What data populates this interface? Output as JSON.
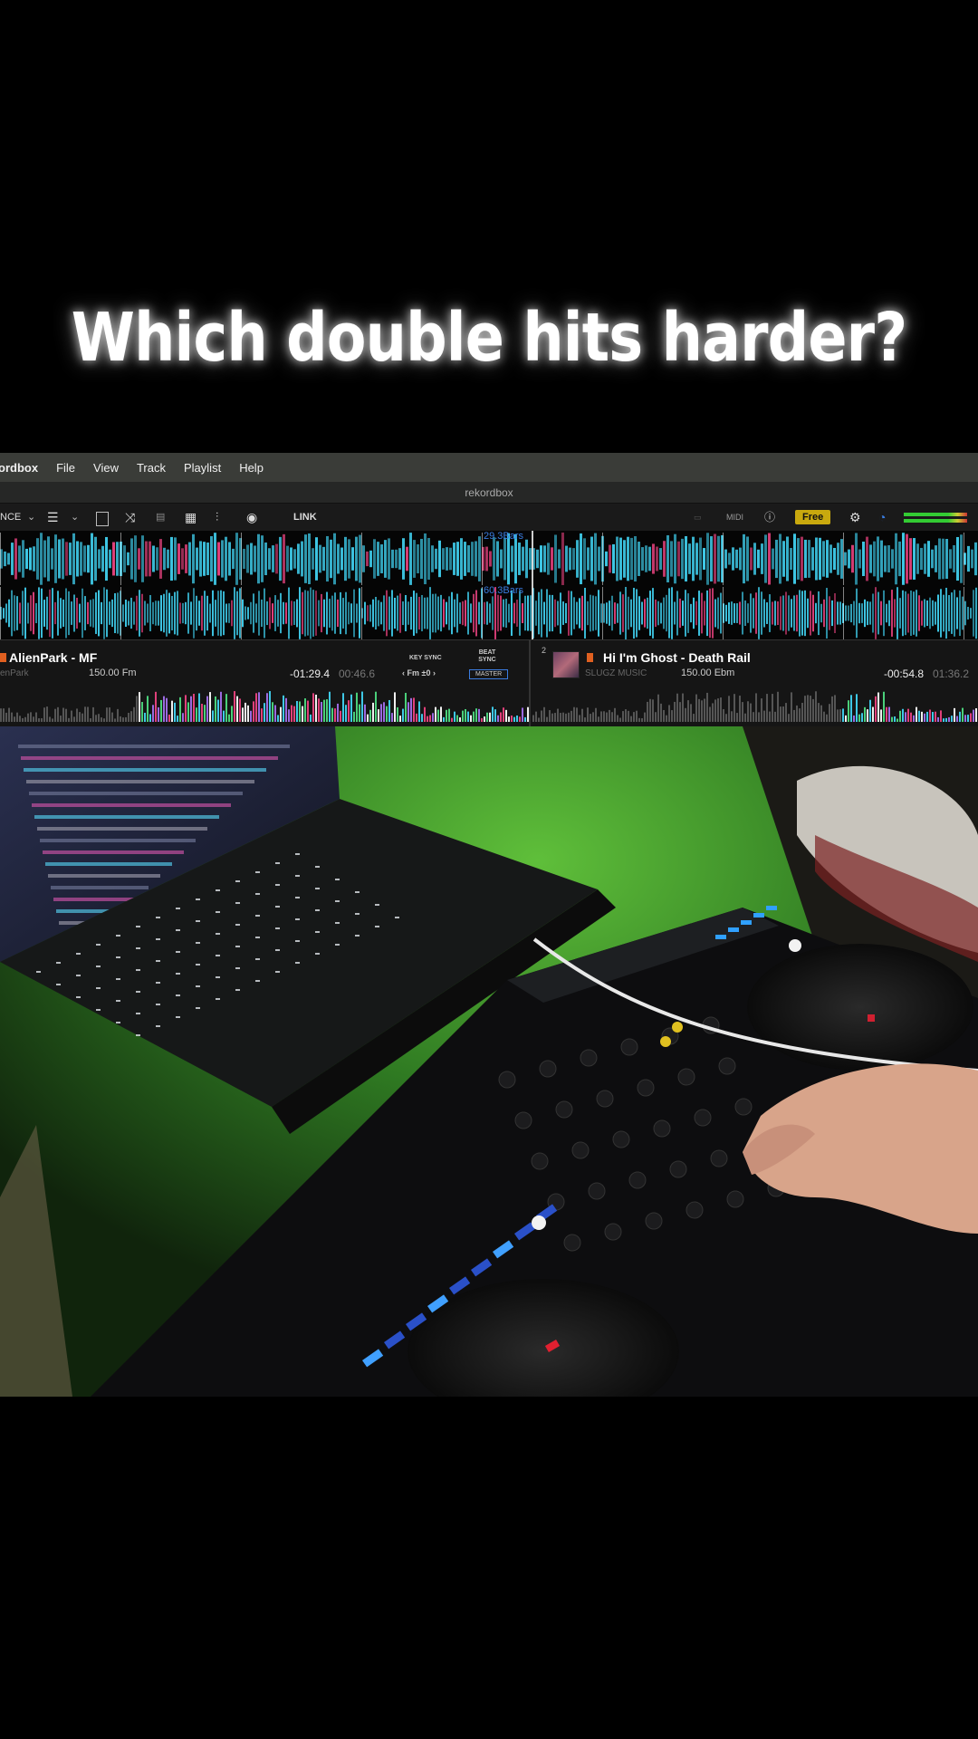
{
  "caption": "Which double hits harder?",
  "menubar": {
    "app_name": "ordbox",
    "items": [
      "File",
      "View",
      "Track",
      "Playlist",
      "Help"
    ]
  },
  "window_title": "rekordbox",
  "toolbar": {
    "mode_label": "NCE",
    "link_label": "LINK",
    "midi_label": "MIDI",
    "free_label": "Free"
  },
  "waveforms": {
    "deck_a_bars": "29.3Bars",
    "deck_b_bars": "60.3Bars"
  },
  "deck_a": {
    "title": "AlienPark - MF",
    "artist": "enPark",
    "bpm_key": "150.00 Fm",
    "remaining": "-01:29.4",
    "elapsed": "00:46.6",
    "key_sync_label": "KEY SYNC",
    "beat_sync_label": "BEAT SYNC",
    "key_value": "‹ Fm  ±0 ›",
    "master_label": "MASTER"
  },
  "deck_b": {
    "number": "2",
    "title": "Hi I'm Ghost - Death Rail",
    "artist": "SLUGZ MUSIC",
    "bpm_key": "150.00 Ebm",
    "remaining": "-00:54.8",
    "elapsed": "01:36.2"
  },
  "colors": {
    "wave_cyan": "#3ec8e6",
    "wave_pink": "#e0407a",
    "accent_blue": "#3a7ce0",
    "free_yellow": "#c9a90e",
    "wall_green": "#3e9e2e"
  }
}
